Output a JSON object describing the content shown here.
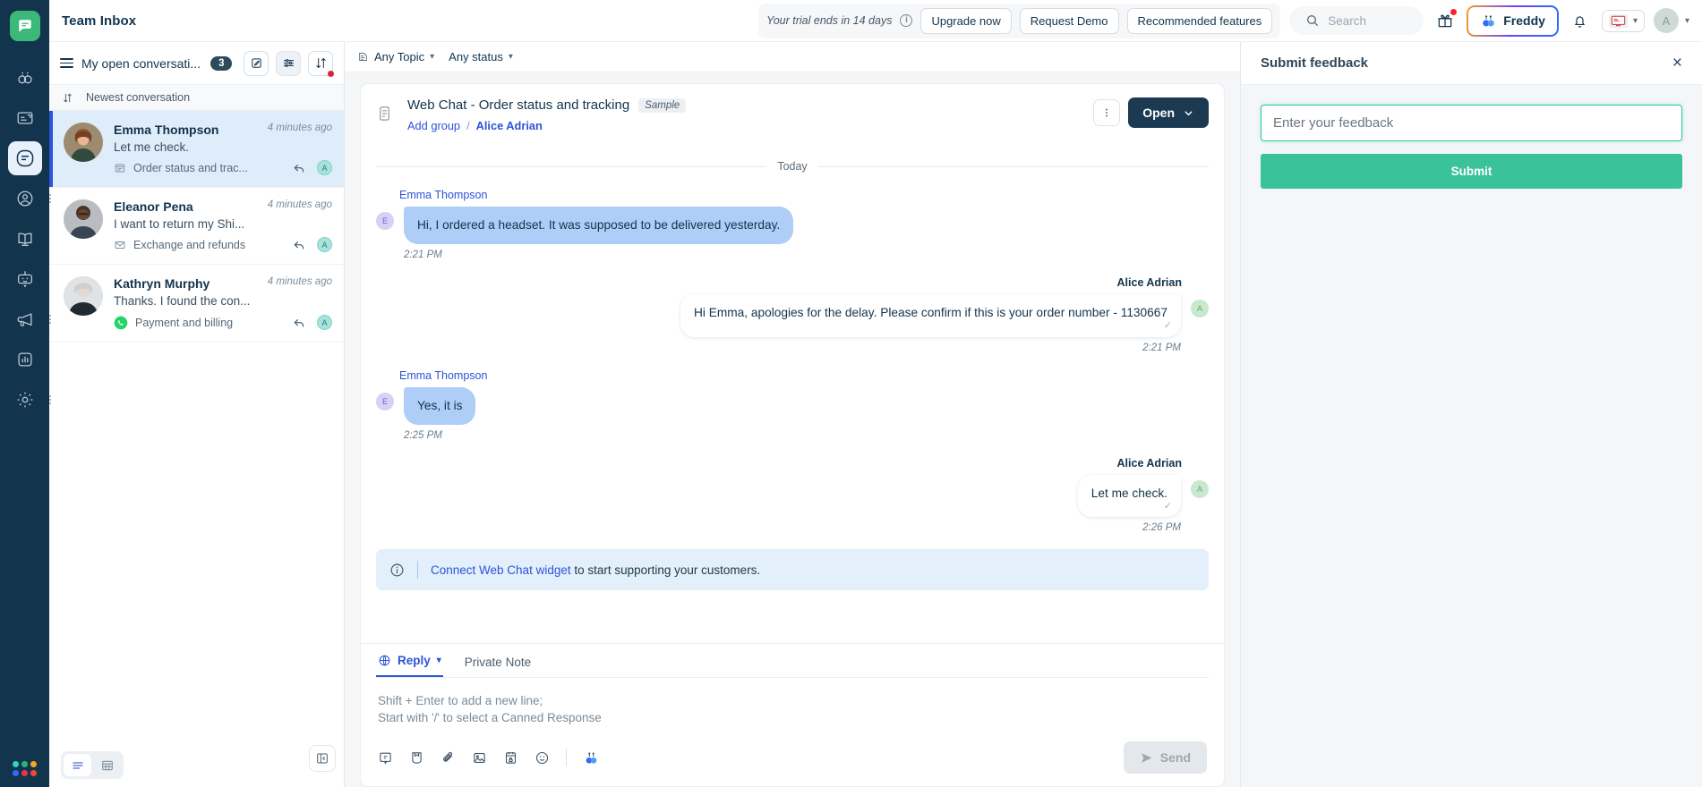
{
  "topbar": {
    "title": "Team Inbox",
    "trial_text": "Your trial ends in 14 days",
    "upgrade_label": "Upgrade now",
    "request_demo_label": "Request Demo",
    "recommended_label": "Recommended features",
    "search_placeholder": "Search",
    "freddy_label": "Freddy",
    "avatar_initial": "A"
  },
  "rail": {
    "items": [
      {
        "name": "freddy-copilot-icon",
        "label": "Freddy Copilot"
      },
      {
        "name": "tickets-icon",
        "label": "Tickets"
      },
      {
        "name": "inbox-icon",
        "label": "Team Inbox"
      },
      {
        "name": "contacts-icon",
        "label": "Contacts"
      },
      {
        "name": "knowledge-base-icon",
        "label": "Knowledge Base"
      },
      {
        "name": "bots-icon",
        "label": "Bots"
      },
      {
        "name": "campaigns-icon",
        "label": "Campaigns"
      },
      {
        "name": "analytics-icon",
        "label": "Analytics"
      },
      {
        "name": "settings-icon",
        "label": "Settings"
      }
    ]
  },
  "conversation_list": {
    "header_title": "My open conversati...",
    "header_count": "3",
    "sort_label": "Newest conversation",
    "items": [
      {
        "name": "Emma Thompson",
        "preview": "Let me check.",
        "topic": "Order status and trac...",
        "topic_icon": "webchat-icon",
        "time": "4 minutes ago",
        "agent_initial": "A",
        "selected": true
      },
      {
        "name": "Eleanor Pena",
        "preview": "I want to return my Shi...",
        "topic": "Exchange and refunds",
        "topic_icon": "email-icon",
        "time": "4 minutes ago",
        "agent_initial": "A",
        "selected": false
      },
      {
        "name": "Kathryn Murphy",
        "preview": "Thanks. I found the con...",
        "topic": "Payment and billing",
        "topic_icon": "whatsapp-icon",
        "time": "4 minutes ago",
        "agent_initial": "A",
        "selected": false
      }
    ]
  },
  "filters": {
    "topic": "Any Topic",
    "status": "Any status"
  },
  "conversation": {
    "title": "Web Chat - Order status and tracking",
    "sample_tag": "Sample",
    "add_group_label": "Add group",
    "separator": "/",
    "assignee": "Alice Adrian",
    "status_label": "Open",
    "day_separator": "Today",
    "messages": [
      {
        "sender": "Emma Thompson",
        "side": "left",
        "avatar_initial": "E",
        "text": "Hi, I ordered a headset. It was supposed to be delivered yesterday.",
        "time": "2:21 PM"
      },
      {
        "sender": "Alice Adrian",
        "side": "right",
        "avatar_initial": "A",
        "text": "Hi Emma, apologies for the delay. Please confirm if this is your order number - 1130667",
        "time": "2:21 PM"
      },
      {
        "sender": "Emma Thompson",
        "side": "left",
        "avatar_initial": "E",
        "text": "Yes, it is",
        "time": "2:25 PM"
      },
      {
        "sender": "Alice Adrian",
        "side": "right",
        "avatar_initial": "A",
        "text": "Let me check.",
        "time": "2:26 PM"
      }
    ],
    "notice_link": "Connect Web Chat widget",
    "notice_text": " to start supporting your customers."
  },
  "composer": {
    "reply_tab": "Reply",
    "private_note_tab": "Private Note",
    "placeholder_line1": "Shift + Enter to add a new line;",
    "placeholder_line2": "Start with '/' to select a Canned Response",
    "send_label": "Send",
    "tool_icons": [
      "canned-response-icon",
      "solutions-icon",
      "attachment-icon",
      "image-icon",
      "scenario-icon",
      "emoji-icon",
      "freddy-assist-icon"
    ]
  },
  "feedback": {
    "title": "Submit feedback",
    "input_placeholder": "Enter your feedback",
    "input_value": "",
    "submit_label": "Submit",
    "close_icon": "×"
  },
  "colors": {
    "rail_bg": "#12344d",
    "brand_green": "#3cb878",
    "accent_blue": "#2c53d8",
    "selected_row": "#dfecf9",
    "incoming_bubble": "#aecdf7",
    "feedback_green": "#3ac39a",
    "status_btn": "#1b3a52"
  }
}
